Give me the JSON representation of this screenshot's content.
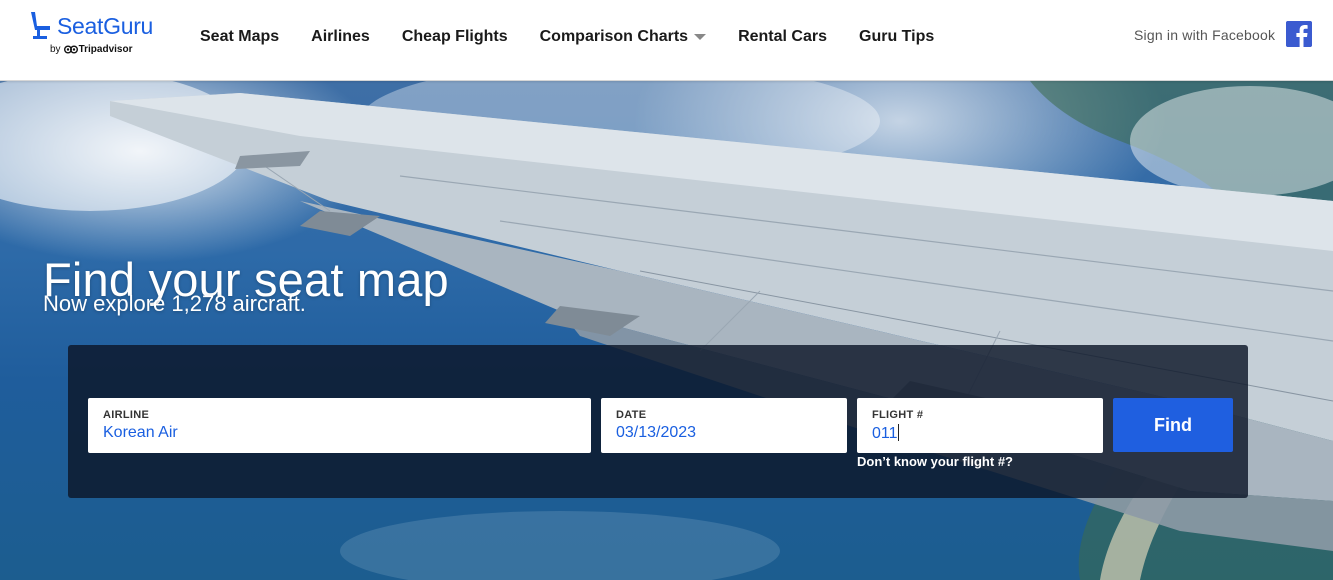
{
  "brand": {
    "name": "SeatGuru",
    "by": "by",
    "partner": "Tripadvisor",
    "color": "#1a5fe0"
  },
  "nav": {
    "items": [
      {
        "label": "Seat Maps"
      },
      {
        "label": "Airlines"
      },
      {
        "label": "Cheap Flights"
      },
      {
        "label": "Comparison Charts",
        "has_dropdown": true
      },
      {
        "label": "Rental Cars"
      },
      {
        "label": "Guru Tips"
      }
    ],
    "signin_label": "Sign in with Facebook",
    "facebook_icon": "facebook-icon"
  },
  "hero": {
    "title": "Find your seat map",
    "subtitle": "Now explore 1,278 aircraft."
  },
  "search": {
    "airline": {
      "label": "AIRLINE",
      "value": "Korean Air"
    },
    "date": {
      "label": "DATE",
      "value": "03/13/2023"
    },
    "flight": {
      "label": "FLIGHT #",
      "value": "011"
    },
    "find_label": "Find",
    "help_link": "Don’t know your flight #?",
    "button_color": "#1f5fe0"
  }
}
